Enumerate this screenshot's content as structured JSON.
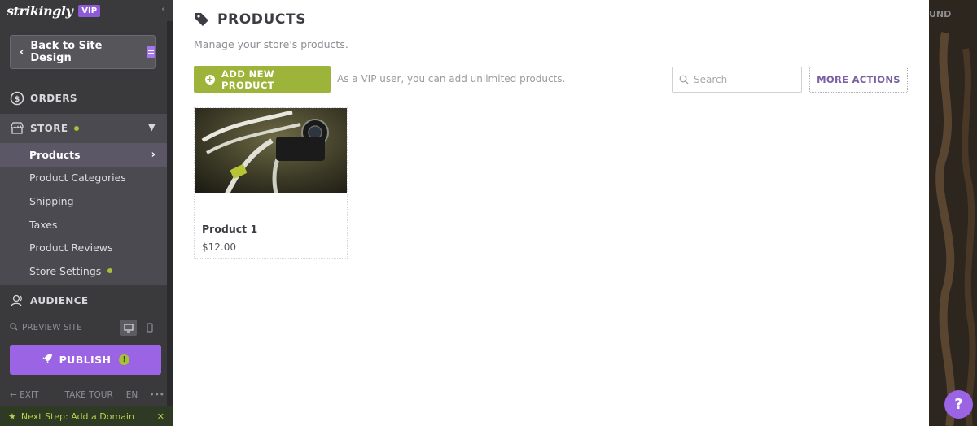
{
  "sidebar": {
    "logo": "strikingly",
    "vip_badge": "VIP",
    "back_label": "Back to Site Design",
    "orders_label": "ORDERS",
    "store_label": "STORE",
    "store_items": [
      {
        "label": "Products"
      },
      {
        "label": "Product Categories"
      },
      {
        "label": "Shipping"
      },
      {
        "label": "Taxes"
      },
      {
        "label": "Product Reviews"
      },
      {
        "label": "Store Settings"
      }
    ],
    "audience_label": "AUDIENCE",
    "preview_label": "PREVIEW SITE",
    "publish_label": "PUBLISH",
    "exit_label": "EXIT",
    "tour_label": "TAKE TOUR",
    "lang_label": "EN",
    "more_label": "•••",
    "next_step_label": "Next Step: Add a Domain"
  },
  "main": {
    "title": "PRODUCTS",
    "subtitle": "Manage your store's products.",
    "add_button_label": "ADD NEW PRODUCT",
    "vip_note": "As a VIP user, you can add unlimited products.",
    "search_placeholder": "Search",
    "more_actions_label": "MORE ACTIONS",
    "products": [
      {
        "name": "Product 1",
        "price": "$12.00"
      }
    ]
  },
  "right_strip": {
    "label": "UND"
  },
  "help_label": "?",
  "colors": {
    "sidebar_bg": "#3a3a3d",
    "accent_purple": "#9a64e4",
    "accent_green": "#9cb43a"
  }
}
